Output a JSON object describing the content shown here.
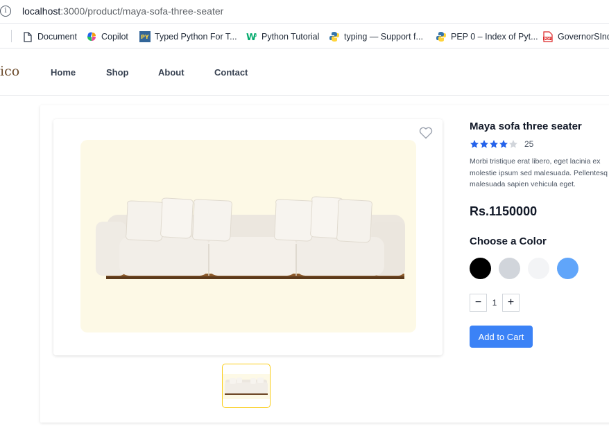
{
  "browser": {
    "url_host": "localhost",
    "url_rest": ":3000/product/maya-sofa-three-seater",
    "bookmarks": [
      {
        "label": "Document",
        "icon": "page-icon"
      },
      {
        "label": "Copilot",
        "icon": "copilot-icon"
      },
      {
        "label": "Typed Python For T...",
        "icon": "py-icon"
      },
      {
        "label": "Python Tutorial",
        "icon": "w3-icon"
      },
      {
        "label": "typing — Support f...",
        "icon": "python-icon"
      },
      {
        "label": "PEP 0 – Index of Pyt...",
        "icon": "python-icon"
      },
      {
        "label": "GovernorSInd",
        "icon": "pdf-icon"
      }
    ]
  },
  "site": {
    "logo": "ico",
    "nav": [
      "Home",
      "Shop",
      "About",
      "Contact"
    ]
  },
  "product": {
    "title": "Maya sofa three seater",
    "rating": 4,
    "rating_max": 5,
    "review_count": "25",
    "description_lines": [
      "Morbi tristique erat libero, eget lacinia ex",
      "molestie ipsum sed malesuada. Pellentesq",
      "malesuada sapien vehicula eget."
    ],
    "price": "Rs.1150000",
    "choose_color_label": "Choose a Color",
    "colors": [
      "#000000",
      "#d1d5db",
      "#f3f4f6",
      "#60a5fa"
    ],
    "quantity": "1",
    "minus_label": "−",
    "plus_label": "+",
    "add_to_cart_label": "Add to Cart",
    "star_color": "#2563eb",
    "star_empty_color": "#d1d5db"
  }
}
